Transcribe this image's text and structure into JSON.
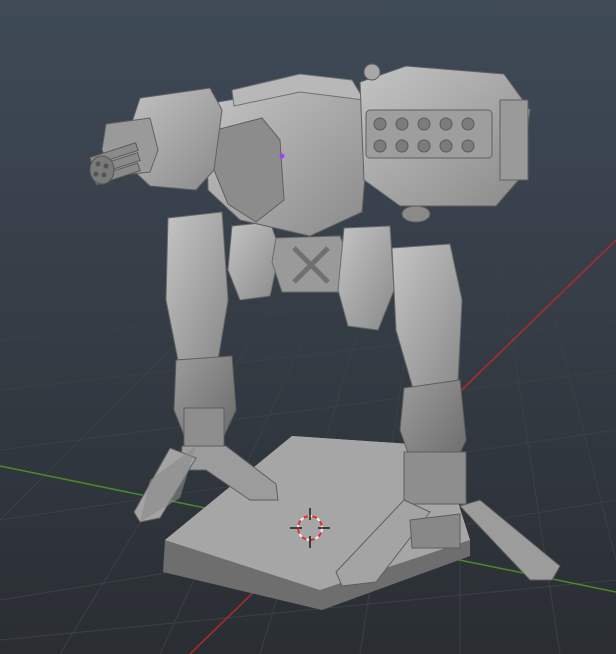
{
  "viewport": {
    "view": "3D viewport",
    "colors": {
      "background_top": "#3f4a57",
      "background_bottom": "#2b2f33",
      "grid_line": "#3b3f44",
      "axis_x": "#b22a2a",
      "axis_y": "#4a8a2a",
      "model_light": "#b0b0b0",
      "model_mid": "#8c8c8c",
      "model_dark": "#5e5e5e",
      "cursor_red": "#e03030",
      "cursor_white": "#f0f0f0",
      "origin_dot": "#a040ff"
    },
    "objects": [
      {
        "name": "mech-miniature",
        "icon": "mech-model"
      },
      {
        "name": "hexagonal-base",
        "icon": "hex-base"
      },
      {
        "name": "3d-cursor",
        "icon": "crosshair-icon"
      }
    ]
  }
}
